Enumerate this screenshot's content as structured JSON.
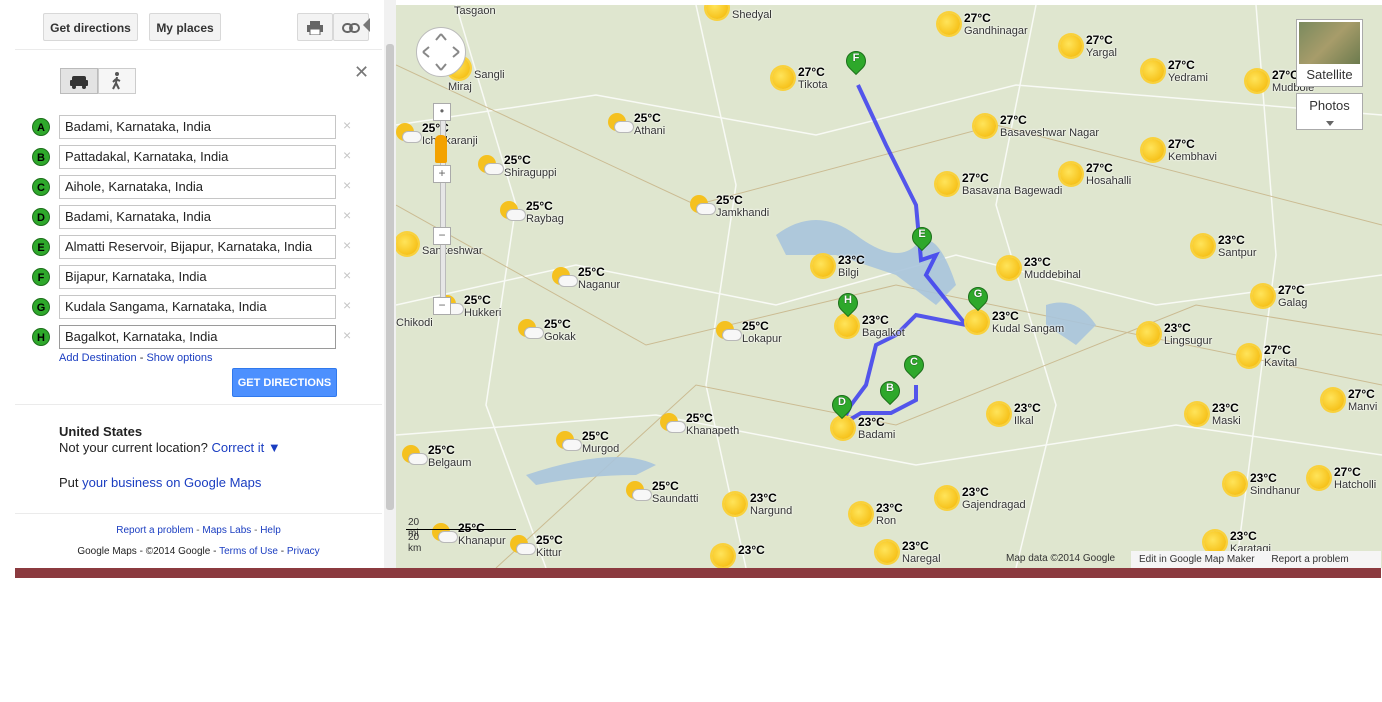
{
  "panel": {
    "get_directions_tab": "Get directions",
    "my_places_tab": "My places",
    "print_icon": "print-icon",
    "link_icon": "link-icon",
    "modes": [
      "car-icon",
      "walk-icon"
    ],
    "waypoints": [
      {
        "letter": "A",
        "value": "Badami, Karnataka, India"
      },
      {
        "letter": "B",
        "value": "Pattadakal, Karnataka, India"
      },
      {
        "letter": "C",
        "value": "Aihole, Karnataka, India"
      },
      {
        "letter": "D",
        "value": "Badami, Karnataka, India"
      },
      {
        "letter": "E",
        "value": "Almatti Reservoir, Bijapur, Karnataka, India"
      },
      {
        "letter": "F",
        "value": "Bijapur, Karnataka, India"
      },
      {
        "letter": "G",
        "value": "Kudala Sangama, Karnataka, India"
      },
      {
        "letter": "H",
        "value": "Bagalkot, Karnataka, India"
      }
    ],
    "remove_glyph": "×",
    "close_glyph": "✕",
    "add_destination": "Add Destination",
    "separator": " - ",
    "show_options": "Show options",
    "get_directions_button": "GET DIRECTIONS",
    "country": "United States",
    "location_question": "Not your current location?",
    "correct_it": "Correct it ▼",
    "put_prefix": "Put",
    "business_link": "your business on Google Maps",
    "footer_links": [
      "Report a problem",
      "Maps Labs",
      "Help"
    ],
    "footer_brand": "Google Maps",
    "footer_copyright": "- ©2014 Google -",
    "footer_terms": "Terms of Use",
    "footer_privacy": "Privacy"
  },
  "map": {
    "map_type_satellite": "Satellite",
    "map_type_photos": "Photos",
    "scale_mi": "20 mi",
    "scale_km": "20 km",
    "attribution": "Map data ©2014 Google",
    "edit_link": "Edit in Google Map Maker",
    "report_link": "Report a problem",
    "route_color": "#3b3bf0",
    "water_color": "#a8c4dc",
    "marker_color": "#2ea82b",
    "weather": [
      {
        "icon": "sun",
        "temp": "",
        "city": "Shedyal"
      },
      {
        "icon": "sun",
        "temp": "27°C",
        "city": "Gandhinagar"
      },
      {
        "icon": "sun",
        "temp": "27°C",
        "city": "Yargal"
      },
      {
        "icon": "sun",
        "temp": "27°C",
        "city": "Yedrami"
      },
      {
        "icon": "sun",
        "temp": "27°C",
        "city": "Mudbole"
      },
      {
        "icon": "sun",
        "temp": "27°C",
        "city": "Tikota"
      },
      {
        "icon": "sun",
        "temp": "",
        "city": "Sangli"
      },
      {
        "icon": "cloudy",
        "temp": "25°C",
        "city": "Athani"
      },
      {
        "icon": "cloudy",
        "temp": "25°C",
        "city": "Ichalkaranji"
      },
      {
        "icon": "sun",
        "temp": "27°C",
        "city": "Basaveshwar Nagar"
      },
      {
        "icon": "sun",
        "temp": "27°C",
        "city": "Kembhavi"
      },
      {
        "icon": "cloudy",
        "temp": "25°C",
        "city": "Shiraguppi"
      },
      {
        "icon": "sun",
        "temp": "27°C",
        "city": "Hosahalli"
      },
      {
        "icon": "sun",
        "temp": "27°C",
        "city": "Basavana Bagewadi"
      },
      {
        "icon": "cloudy",
        "temp": "25°C",
        "city": "Raybag"
      },
      {
        "icon": "cloudy",
        "temp": "25°C",
        "city": "Jamkhandi"
      },
      {
        "icon": "sun",
        "temp": "23°C",
        "city": "Santpur"
      },
      {
        "icon": "sun",
        "temp": "",
        "city": "Sankeshwar"
      },
      {
        "icon": "sun",
        "temp": "23°C",
        "city": "Bilgi"
      },
      {
        "icon": "sun",
        "temp": "23°C",
        "city": "Muddebihal"
      },
      {
        "icon": "cloudy",
        "temp": "25°C",
        "city": "Naganur"
      },
      {
        "icon": "sun",
        "temp": "27°C",
        "city": "Galag"
      },
      {
        "icon": "cloudy",
        "temp": "25°C",
        "city": "Hukkeri"
      },
      {
        "icon": "sun",
        "temp": "23°C",
        "city": "Kudal Sangam"
      },
      {
        "icon": "sun",
        "temp": "23°C",
        "city": "Bagalkot"
      },
      {
        "icon": "cloudy",
        "temp": "25°C",
        "city": "Gokak"
      },
      {
        "icon": "cloudy",
        "temp": "25°C",
        "city": "Lokapur"
      },
      {
        "icon": "sun",
        "temp": "23°C",
        "city": "Lingsugur"
      },
      {
        "icon": "sun",
        "temp": "27°C",
        "city": "Kavital"
      },
      {
        "icon": "sun",
        "temp": "27°C",
        "city": "Manvi"
      },
      {
        "icon": "sun",
        "temp": "23°C",
        "city": "Ilkal"
      },
      {
        "icon": "sun",
        "temp": "23°C",
        "city": "Maski"
      },
      {
        "icon": "cloudy",
        "temp": "25°C",
        "city": "Khanapeth"
      },
      {
        "icon": "sun",
        "temp": "23°C",
        "city": "Badami"
      },
      {
        "icon": "cloudy",
        "temp": "25°C",
        "city": "Murgod"
      },
      {
        "icon": "cloudy",
        "temp": "25°C",
        "city": "Belgaum"
      },
      {
        "icon": "sun",
        "temp": "23°C",
        "city": "Sindhanur"
      },
      {
        "icon": "sun",
        "temp": "27°C",
        "city": "Hatcholli"
      },
      {
        "icon": "cloudy",
        "temp": "25°C",
        "city": "Saundatti"
      },
      {
        "icon": "sun",
        "temp": "23°C",
        "city": "Nargund"
      },
      {
        "icon": "sun",
        "temp": "23°C",
        "city": "Gajendragad"
      },
      {
        "icon": "sun",
        "temp": "23°C",
        "city": "Ron"
      },
      {
        "icon": "cloudy",
        "temp": "25°C",
        "city": "Khanapur"
      },
      {
        "icon": "cloudy",
        "temp": "25°C",
        "city": "Kittur"
      },
      {
        "icon": "sun",
        "temp": "23°C",
        "city": ""
      },
      {
        "icon": "sun",
        "temp": "23°C",
        "city": "Naregal"
      },
      {
        "icon": "sun",
        "temp": "23°C",
        "city": "Karatagi"
      }
    ],
    "markers": [
      "F",
      "E",
      "G",
      "H",
      "C",
      "B",
      "D"
    ],
    "other_labels": [
      "Tasgaon",
      "Miraj",
      "Chikodi"
    ]
  }
}
